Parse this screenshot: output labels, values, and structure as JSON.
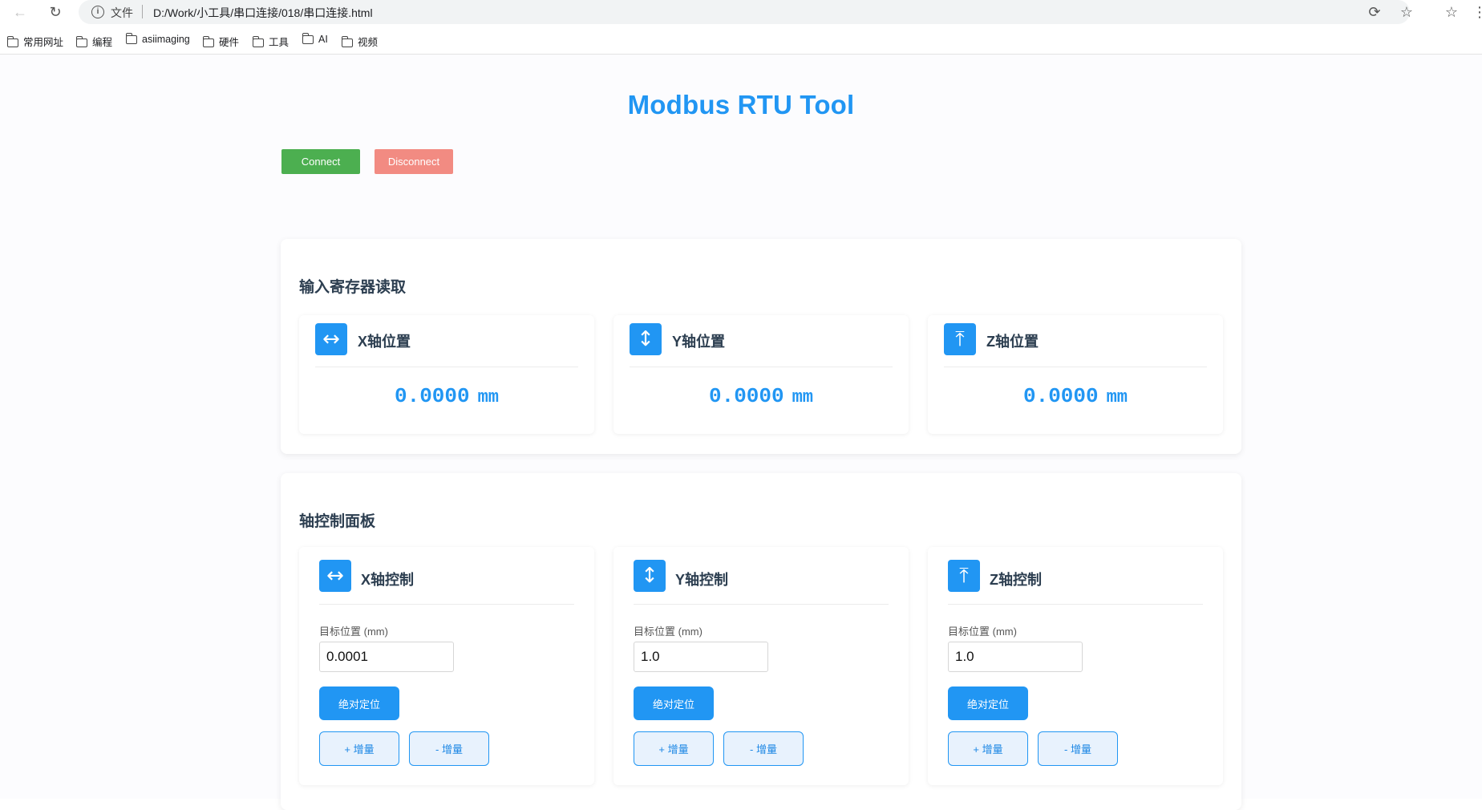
{
  "browser": {
    "scheme_label": "文件",
    "url": "D:/Work/小工具/串口连接/018/串口连接.html",
    "bookmarks": [
      "常用网址",
      "编程",
      "asiimaging",
      "硬件",
      "工具",
      "AI",
      "视频"
    ]
  },
  "page": {
    "title": "Modbus RTU Tool",
    "connect_label": "Connect",
    "disconnect_label": "Disconnect"
  },
  "colors": {
    "accent": "#2196f3",
    "connect": "#4caf50",
    "disconnect": "#f28b82"
  },
  "read_section": {
    "title": "输入寄存器读取",
    "axes": [
      {
        "icon": "horizontal-arrows-icon",
        "name": "X轴位置",
        "value": "0.0000",
        "unit": "mm"
      },
      {
        "icon": "vertical-arrows-icon",
        "name": "Y轴位置",
        "value": "0.0000",
        "unit": "mm"
      },
      {
        "icon": "up-arrow-bar-icon",
        "name": "Z轴位置",
        "value": "0.0000",
        "unit": "mm"
      }
    ]
  },
  "control_section": {
    "title": "轴控制面板",
    "axes": [
      {
        "icon": "horizontal-arrows-icon",
        "name": "X轴控制",
        "field_label": "目标位置 (mm)",
        "target": "0.0001",
        "abs_label": "绝对定位",
        "inc_plus_label": "+ 增量",
        "inc_minus_label": "- 增量"
      },
      {
        "icon": "vertical-arrows-icon",
        "name": "Y轴控制",
        "field_label": "目标位置 (mm)",
        "target": "1.0",
        "abs_label": "绝对定位",
        "inc_plus_label": "+ 增量",
        "inc_minus_label": "- 增量"
      },
      {
        "icon": "up-arrow-bar-icon",
        "name": "Z轴控制",
        "field_label": "目标位置 (mm)",
        "target": "1.0",
        "abs_label": "绝对定位",
        "inc_plus_label": "+ 增量",
        "inc_minus_label": "- 增量"
      }
    ]
  }
}
